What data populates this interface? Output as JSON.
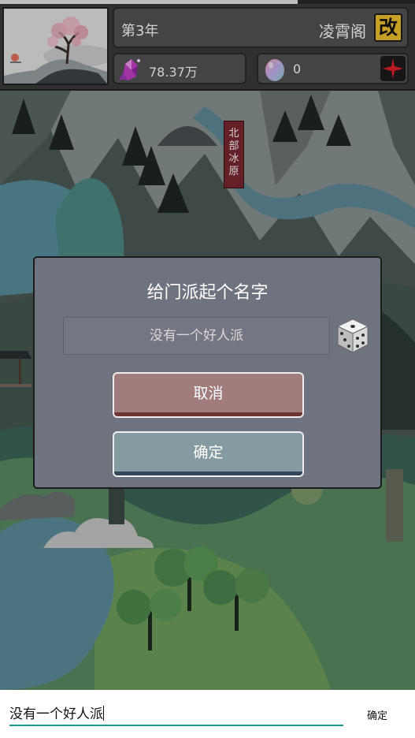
{
  "header": {
    "year_label": "第3年",
    "sect_name": "凌霄阁",
    "rename_label": "改",
    "crystal_amount": "78.37万",
    "egg_amount": "0"
  },
  "map": {
    "region_label_chars": [
      "北",
      "部",
      "冰",
      "原"
    ]
  },
  "dialog": {
    "title": "给门派起个名字",
    "name_value": "没有一个好人派",
    "cancel_label": "取消",
    "confirm_label": "确定"
  },
  "ime": {
    "input_value": "没有一个好人派",
    "confirm_label": "确定"
  },
  "colors": {
    "accent_yellow": "#f2c230",
    "add_red": "#e3202a",
    "cancel_button": "#a07c7c",
    "confirm_button": "#849ba2",
    "ime_underline": "#1a9a8a"
  },
  "icons": {
    "crystal": "pink-crystal-icon",
    "egg": "spirit-egg-icon",
    "dice": "dice-icon",
    "add": "plus-icon"
  }
}
